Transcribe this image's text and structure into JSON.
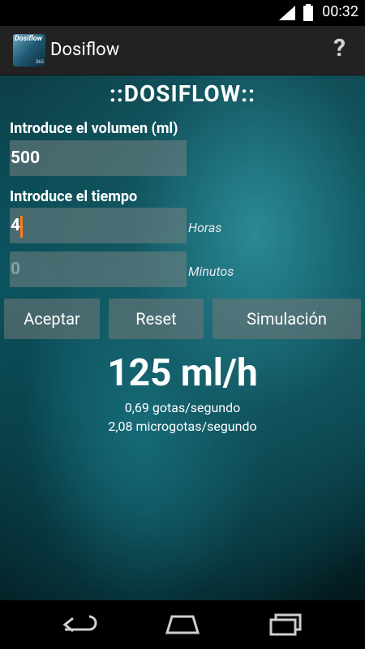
{
  "status": {
    "time": "00:32"
  },
  "actionbar": {
    "title": "Dosiflow",
    "icon_text": "Dosiflow",
    "icon_sub": "365",
    "help": "?"
  },
  "main": {
    "heading": "::DOSIFLOW::",
    "volume_label": "Introduce el volumen (ml)",
    "volume_value": "500",
    "time_label": "Introduce el tiempo",
    "hours_value": "4",
    "hours_unit": "Horas",
    "minutes_placeholder": "0",
    "minutes_unit": "Minutos",
    "buttons": {
      "accept": "Aceptar",
      "reset": "Reset",
      "simulate": "Simulación"
    },
    "result": "125 ml/h",
    "drops": "0,69 gotas/segundo",
    "microdrops": "2,08 microgotas/segundo"
  },
  "navbar": {
    "icons": [
      "back-icon",
      "home-icon",
      "recent-apps-icon"
    ]
  }
}
